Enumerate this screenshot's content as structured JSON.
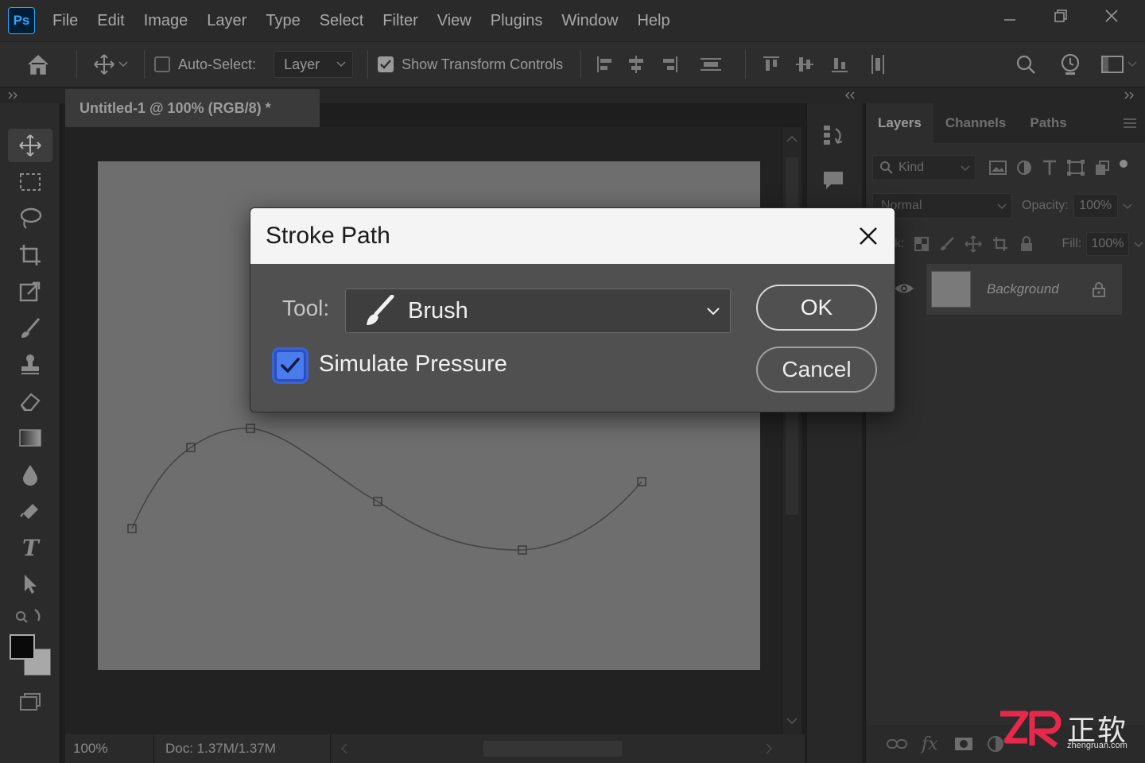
{
  "app": {
    "logo": "Ps",
    "menu": [
      "File",
      "Edit",
      "Image",
      "Layer",
      "Type",
      "Select",
      "Filter",
      "View",
      "Plugins",
      "Window",
      "Help"
    ],
    "window_controls": {
      "minimize": "—",
      "restore": "❐",
      "close": "✕"
    }
  },
  "options_bar": {
    "auto_select_label": "Auto-Select:",
    "auto_select_checked": false,
    "auto_select_target": "Layer",
    "show_transform_label": "Show Transform Controls",
    "show_transform_checked": true
  },
  "document": {
    "tab_title": "Untitled-1 @ 100% (RGB/8) *",
    "zoom": "100%",
    "doc_size": "Doc: 1.37M/1.37M",
    "path_points_note": ""
  },
  "layers_panel": {
    "tabs": [
      "Layers",
      "Channels",
      "Paths"
    ],
    "active_tab": "Layers",
    "filter_kind": "Kind",
    "blend_mode": "Normal",
    "opacity_label": "Opacity:",
    "opacity": "100%",
    "lock_label": "k:",
    "fill_label": "Fill:",
    "fill": "100%",
    "layers": [
      {
        "name": "Background",
        "locked": true,
        "visible": true
      }
    ],
    "footer_fx": "fx"
  },
  "dialog": {
    "title": "Stroke Path",
    "tool_label": "Tool:",
    "tool_value": "Brush",
    "simulate_pressure_label": "Simulate Pressure",
    "simulate_pressure_checked": true,
    "ok_label": "OK",
    "cancel_label": "Cancel"
  },
  "watermark": {
    "brand_cn": "正软",
    "url": "zhengruan.com"
  },
  "colors": {
    "accent_blue": "#4b7bec",
    "ps_blue": "#31a8ff",
    "watermark_red": "#e8284a",
    "foreground": "#0a0a0a",
    "background": "#a8a8a8"
  }
}
